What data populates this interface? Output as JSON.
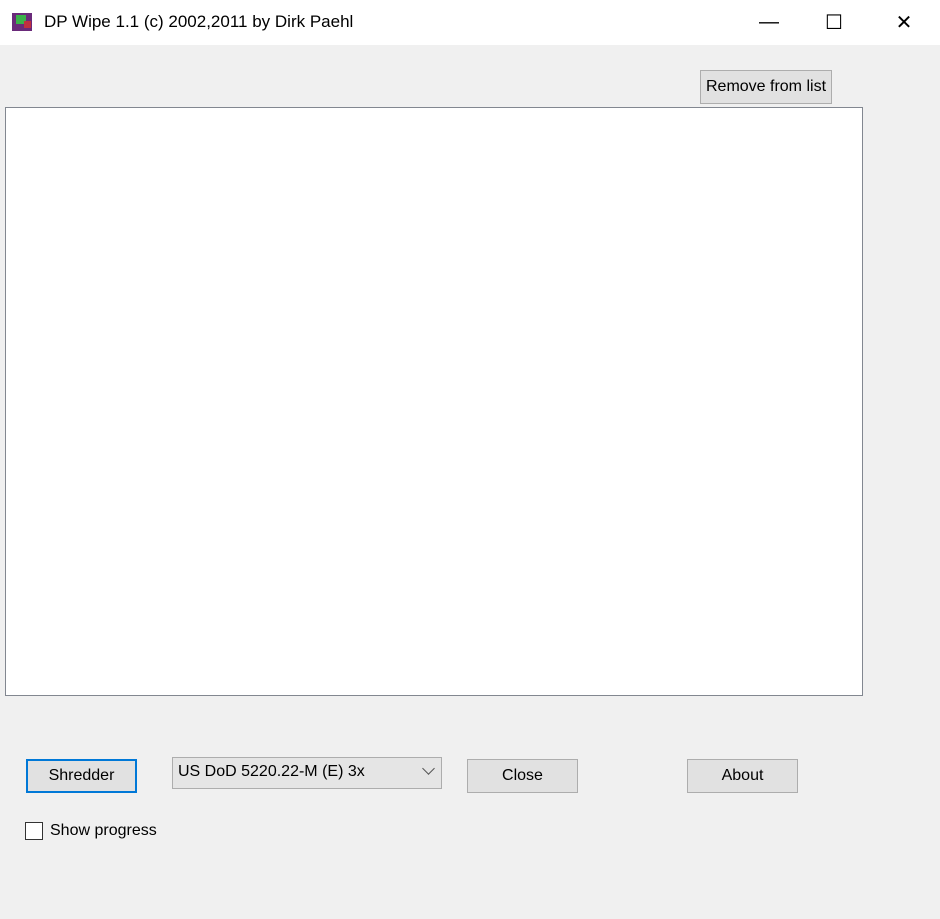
{
  "window": {
    "title": "DP Wipe 1.1 (c) 2002,2011 by Dirk Paehl",
    "icon": "app-icon",
    "minimize": "—",
    "maximize": "☐",
    "close": "✕"
  },
  "toolbar": {
    "remove_label": "Remove from list"
  },
  "file_list": {
    "items": []
  },
  "controls": {
    "shredder_label": "Shredder",
    "method_selected": "US DoD 5220.22-M (E) 3x",
    "close_label": "Close",
    "about_label": "About",
    "show_progress_label": "Show progress",
    "show_progress_checked": false
  },
  "colors": {
    "accent": "#0078d7"
  }
}
